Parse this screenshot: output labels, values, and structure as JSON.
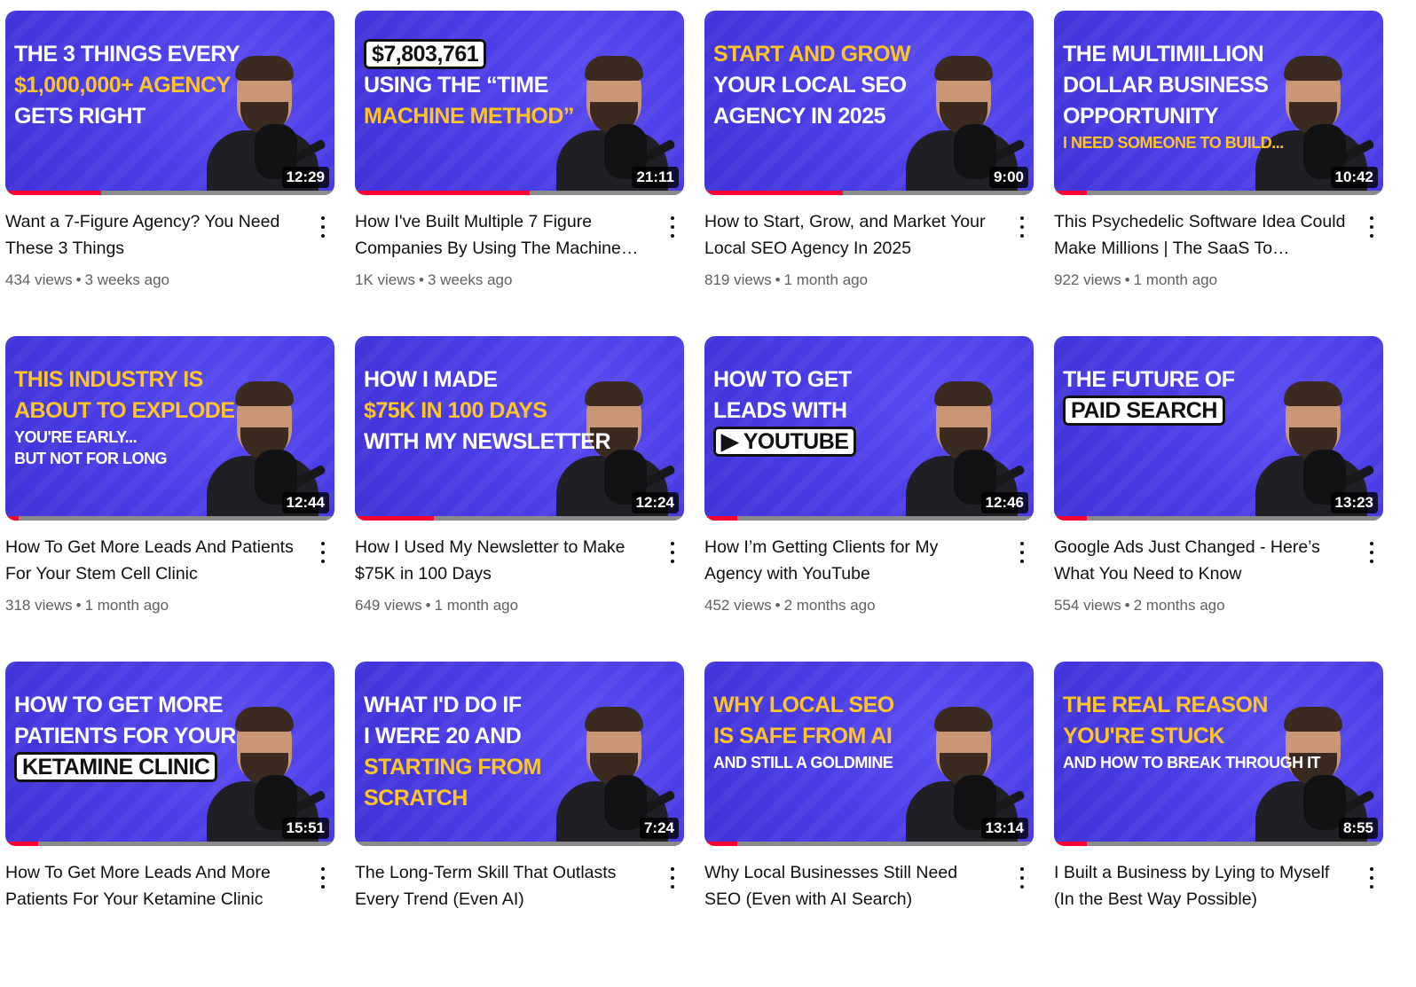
{
  "videos": [
    {
      "title": "Want a 7-Figure Agency? You Need These 3 Things",
      "views": "434 views",
      "age": "3 weeks ago",
      "duration": "12:29",
      "progress": 0.29,
      "thumb_lines": [
        {
          "text": "THE 3 THINGS EVERY",
          "yellow": false
        },
        {
          "text": "$1,000,000+ AGENCY",
          "yellow": true
        },
        {
          "text": "GETS RIGHT",
          "yellow": false
        }
      ]
    },
    {
      "title": "How I've Built Multiple 7 Figure Companies By Using The Machine…",
      "views": "1K views",
      "age": "3 weeks ago",
      "duration": "21:11",
      "progress": 0.53,
      "thumb_lines": [
        {
          "text": "$7,803,761",
          "yellow": false,
          "box": true
        },
        {
          "text": "USING THE “TIME",
          "yellow": false
        },
        {
          "text": "MACHINE METHOD”",
          "yellow": true
        }
      ]
    },
    {
      "title": "How to Start, Grow, and Market Your Local SEO Agency In 2025",
      "views": "819 views",
      "age": "1 month ago",
      "duration": "9:00",
      "progress": 0.42,
      "thumb_lines": [
        {
          "text": "START AND GROW",
          "yellow": true
        },
        {
          "text": "YOUR LOCAL SEO",
          "yellow": false
        },
        {
          "text": "AGENCY IN 2025",
          "yellow": false
        }
      ]
    },
    {
      "title": "This Psychedelic Software Idea Could Make Millions | The SaaS To…",
      "views": "922 views",
      "age": "1 month ago",
      "duration": "10:42",
      "progress": 0.1,
      "thumb_lines": [
        {
          "text": "THE MULTIMILLION",
          "yellow": false
        },
        {
          "text": "DOLLAR BUSINESS",
          "yellow": false
        },
        {
          "text": "OPPORTUNITY",
          "yellow": false
        },
        {
          "text": "I NEED SOMEONE TO BUILD...",
          "yellow": true,
          "small": true
        }
      ]
    },
    {
      "title": "How To Get More Leads And Patients For Your Stem Cell Clinic",
      "views": "318 views",
      "age": "1 month ago",
      "duration": "12:44",
      "progress": 0.04,
      "thumb_lines": [
        {
          "text": "THIS INDUSTRY IS",
          "yellow": true
        },
        {
          "text": "ABOUT TO EXPLODE",
          "yellow": true
        },
        {
          "text": "YOU'RE EARLY...",
          "yellow": false,
          "small": true
        },
        {
          "text": "BUT NOT FOR LONG",
          "yellow": false,
          "small": true
        }
      ]
    },
    {
      "title": "How I Used My Newsletter to Make $75K in 100 Days",
      "views": "649 views",
      "age": "1 month ago",
      "duration": "12:24",
      "progress": 0.24,
      "thumb_lines": [
        {
          "text": "HOW I MADE",
          "yellow": false
        },
        {
          "text": "$75K IN 100 DAYS",
          "yellow": true
        },
        {
          "text": "WITH MY NEWSLETTER",
          "yellow": false
        }
      ]
    },
    {
      "title": "How I’m Getting Clients for My Agency with YouTube",
      "views": "452 views",
      "age": "2 months ago",
      "duration": "12:46",
      "progress": 0.1,
      "thumb_lines": [
        {
          "text": "HOW TO GET",
          "yellow": false
        },
        {
          "text": "LEADS WITH",
          "yellow": false
        },
        {
          "text": "▶ YouTube",
          "yellow": false,
          "box": true
        }
      ]
    },
    {
      "title": "Google Ads Just Changed - Here’s What You Need to Know",
      "views": "554 views",
      "age": "2 months ago",
      "duration": "13:23",
      "progress": 0.1,
      "thumb_lines": [
        {
          "text": "THE FUTURE OF",
          "yellow": false
        },
        {
          "text": "PAID SEARCH",
          "yellow": false,
          "box": true
        }
      ]
    },
    {
      "title": "How To Get More Leads And More Patients For Your Ketamine Clinic",
      "views": "",
      "age": "",
      "duration": "15:51",
      "progress": 0.1,
      "thumb_lines": [
        {
          "text": "HOW TO GET MORE",
          "yellow": false
        },
        {
          "text": "PATIENTS FOR YOUR",
          "yellow": false
        },
        {
          "text": "KETAMINE CLINIC",
          "yellow": false,
          "box": true
        }
      ]
    },
    {
      "title": "The Long-Term Skill That Outlasts Every Trend (Even AI)",
      "views": "",
      "age": "",
      "duration": "7:24",
      "progress": 0.0,
      "thumb_lines": [
        {
          "text": "WHAT I'D DO IF",
          "yellow": false
        },
        {
          "text": "I WERE 20 AND",
          "yellow": false
        },
        {
          "text": "STARTING FROM",
          "yellow": true
        },
        {
          "text": "SCRATCH",
          "yellow": true
        }
      ]
    },
    {
      "title": "Why Local Businesses Still Need SEO (Even with AI Search)",
      "views": "",
      "age": "",
      "duration": "13:14",
      "progress": 0.1,
      "thumb_lines": [
        {
          "text": "WHY LOCAL SEO",
          "yellow": true
        },
        {
          "text": "IS SAFE FROM AI",
          "yellow": true
        },
        {
          "text": "AND STILL A GOLDMINE",
          "yellow": false,
          "small": true
        }
      ]
    },
    {
      "title": "I Built a Business by Lying to Myself (In the Best Way Possible)",
      "views": "",
      "age": "",
      "duration": "8:55",
      "progress": 0.1,
      "thumb_lines": [
        {
          "text": "THE REAL REASON",
          "yellow": true
        },
        {
          "text": "YOU'RE STUCK",
          "yellow": true
        },
        {
          "text": "AND HOW TO BREAK THROUGH IT",
          "yellow": false,
          "small": true
        }
      ]
    }
  ],
  "colors": {
    "thumb_bg": "#4b3de6",
    "highlight": "#ffc426",
    "progress": "#ff0033"
  }
}
